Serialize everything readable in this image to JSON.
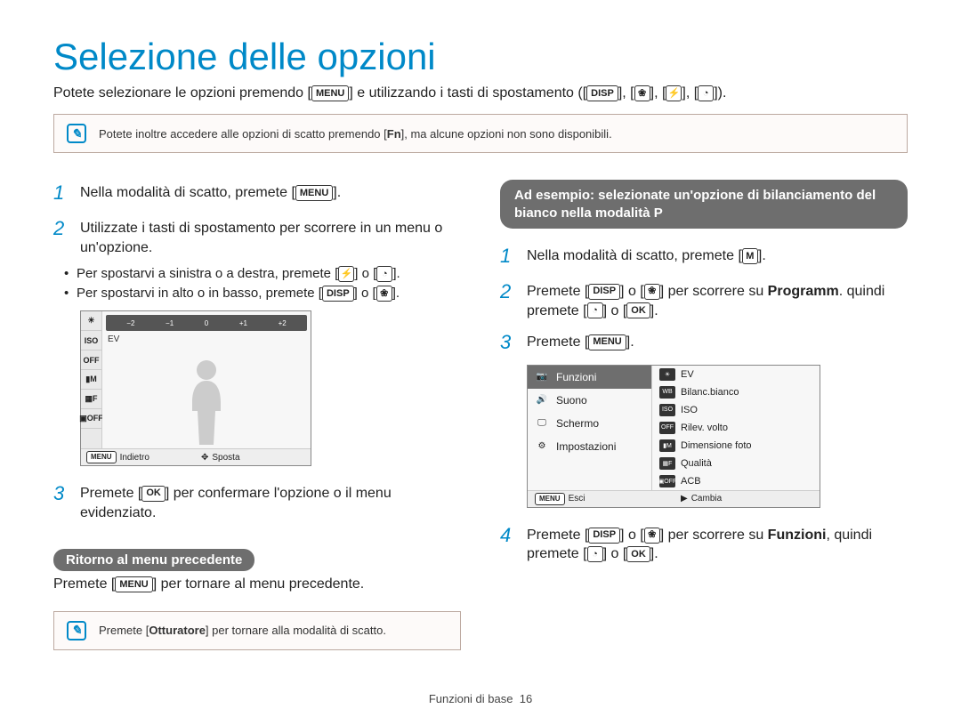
{
  "title": "Selezione delle opzioni",
  "intro": {
    "pre": "Potete selezionare le opzioni premendo [",
    "menu_key": "MENU",
    "mid": "] e utilizzando i tasti di spostamento ([",
    "disp_key": "DISP",
    "sep": "], [",
    "macro_icon": "❀",
    "flash_icon": "⚡",
    "timer_icon": "◔",
    "end": "])."
  },
  "note1": {
    "pre": "Potete inoltre accedere alle opzioni di scatto premendo [",
    "fn_key": "Fn",
    "post": "], ma alcune opzioni non sono disponibili."
  },
  "left": {
    "step1": {
      "n": "1",
      "pre": "Nella modalità di scatto, premete [",
      "menu": "MENU",
      "post": "]."
    },
    "step2": {
      "n": "2",
      "text": "Utilizzate i tasti di spostamento per scorrere in un menu o un'opzione."
    },
    "bullet1": {
      "pre": "Per spostarvi a sinistra o a destra, premete [",
      "flash": "⚡",
      "mid": "] o [",
      "timer": "◔",
      "post": "]."
    },
    "bullet2": {
      "pre": "Per spostarvi in alto o in basso, premete [",
      "disp": "DISP",
      "mid": "] o [",
      "macro": "❀",
      "post": "]."
    },
    "lcd": {
      "ev_ticks": [
        "−2",
        "−1",
        "0",
        "+1",
        "+2"
      ],
      "ev_label": "EV",
      "side_icons": [
        "☀",
        "ISO",
        "OFF",
        "▮M",
        "▦F",
        "▣OFF"
      ],
      "back_key": "MENU",
      "back_label": "Indietro",
      "move_icon": "✥",
      "move_label": "Sposta"
    },
    "step3": {
      "n": "3",
      "pre": "Premete [",
      "ok": "OK",
      "post": "] per confermare l'opzione o il menu evidenziato."
    },
    "return_pill": "Ritorno al menu precedente",
    "return_text": {
      "pre": "Premete [",
      "menu": "MENU",
      "post": "] per tornare al menu precedente."
    },
    "note2": {
      "pre": "Premete [",
      "shutter": "Otturatore",
      "post": "] per tornare alla modalità di scatto."
    }
  },
  "right": {
    "banner": "Ad esempio: selezionate un'opzione di bilanciamento del bianco nella modalità P",
    "step1": {
      "n": "1",
      "pre": "Nella modalità di scatto, premete [",
      "mode": "M",
      "post": "]."
    },
    "step2": {
      "n": "2",
      "pre": "Premete [",
      "disp": "DISP",
      "mid1": "] o [",
      "macro": "❀",
      "mid2": "] per scorrere su ",
      "bold1": "Programm",
      "mid3": ". quindi premete [",
      "timer": "◔",
      "mid4": "] o [",
      "ok": "OK",
      "post": "]."
    },
    "step3": {
      "n": "3",
      "pre": "Premete [",
      "menu": "MENU",
      "post": "]."
    },
    "menu": {
      "left_items": [
        {
          "icon": "📷",
          "label": "Funzioni",
          "selected": true
        },
        {
          "icon": "🔊",
          "label": "Suono",
          "selected": false
        },
        {
          "icon": "🖵",
          "label": "Schermo",
          "selected": false
        },
        {
          "icon": "⚙",
          "label": "Impostazioni",
          "selected": false
        }
      ],
      "right_items": [
        {
          "icon": "☀",
          "label": "EV"
        },
        {
          "icon": "WB",
          "label": "Bilanc.bianco"
        },
        {
          "icon": "ISO",
          "label": "ISO"
        },
        {
          "icon": "OFF",
          "label": "Rilev. volto"
        },
        {
          "icon": "▮M",
          "label": "Dimensione foto"
        },
        {
          "icon": "▦F",
          "label": "Qualità"
        },
        {
          "icon": "▣OFF",
          "label": "ACB"
        }
      ],
      "exit_key": "MENU",
      "exit_label": "Esci",
      "change_icon": "▶",
      "change_label": "Cambia"
    },
    "step4": {
      "n": "4",
      "pre": "Premete [",
      "disp": "DISP",
      "mid1": "] o [",
      "macro": "❀",
      "mid2": "] per scorrere su ",
      "bold1": "Funzioni",
      "mid3": ", quindi premete [",
      "timer": "◔",
      "mid4": "] o [",
      "ok": "OK",
      "post": "]."
    }
  },
  "footer": {
    "section": "Funzioni di base",
    "page": "16"
  }
}
